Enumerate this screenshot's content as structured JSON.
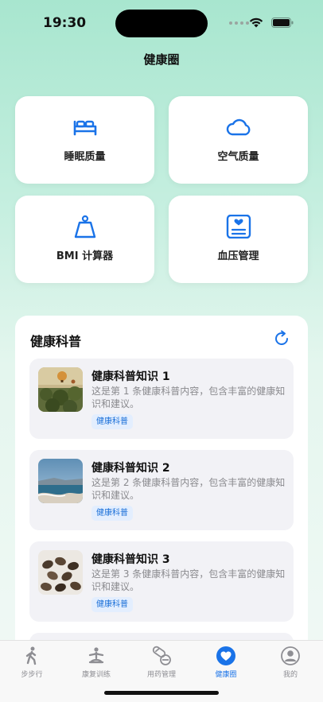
{
  "status": {
    "time": "19:30"
  },
  "nav": {
    "title": "健康圈"
  },
  "tiles": [
    {
      "label": "睡眠质量",
      "icon": "bed-icon"
    },
    {
      "label": "空气质量",
      "icon": "cloud-icon"
    },
    {
      "label": "BMI 计算器",
      "icon": "scale-icon"
    },
    {
      "label": "血压管理",
      "icon": "heart-chart-icon"
    }
  ],
  "science": {
    "title": "健康科普",
    "items": [
      {
        "title": "健康科普知识 1",
        "desc": "这是第 1 条健康科普内容，包含丰富的健康知识和建议。",
        "tag": "健康科普"
      },
      {
        "title": "健康科普知识 2",
        "desc": "这是第 2 条健康科普内容，包含丰富的健康知识和建议。",
        "tag": "健康科普"
      },
      {
        "title": "健康科普知识 3",
        "desc": "这是第 3 条健康科普内容，包含丰富的健康知识和建议。",
        "tag": "健康科普"
      }
    ]
  },
  "tabs": [
    {
      "label": "步步行",
      "active": false
    },
    {
      "label": "康复训练",
      "active": false
    },
    {
      "label": "用药管理",
      "active": false
    },
    {
      "label": "健康圈",
      "active": true
    },
    {
      "label": "我的",
      "active": false
    }
  ],
  "colors": {
    "accent": "#1a73e8",
    "tag_bg": "#e3eefe"
  }
}
